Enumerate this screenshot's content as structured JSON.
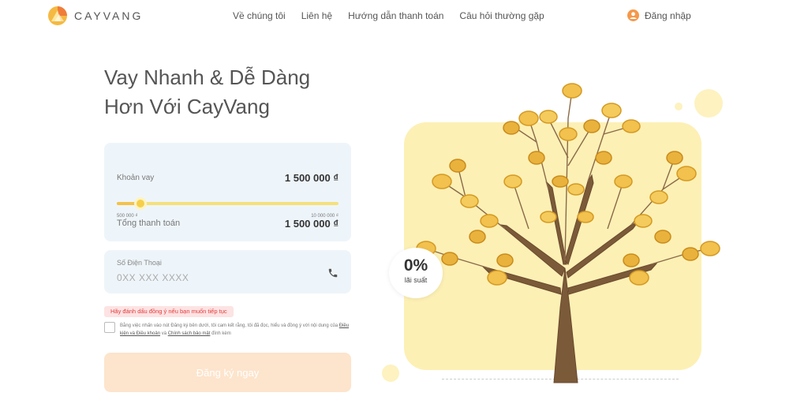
{
  "header": {
    "brand": "CAYVANG",
    "nav": [
      {
        "label": "Về chúng tôi"
      },
      {
        "label": "Liên hệ"
      },
      {
        "label": "Hướng dẫn thanh toán"
      },
      {
        "label": "Câu hỏi thường gặp"
      }
    ],
    "login_label": "Đăng nhập"
  },
  "hero": {
    "title_line1": "Vay Nhanh & Dễ Dàng",
    "title_line2": "Hơn Với CayVang"
  },
  "loan": {
    "label": "Khoản vay",
    "amount": "1 500 000 ₫",
    "slider_min": "500 000 ₫",
    "slider_max": "10 000 000 ₫",
    "slider_fraction": 0.105,
    "total_label": "Tổng thanh toán",
    "total_amount": "1 500 000 ₫"
  },
  "phone": {
    "label": "Số Điện Thoại",
    "placeholder": "0XX XXX XXXX",
    "icon": "phone-icon"
  },
  "agreement": {
    "warning": "Hãy đánh dấu đồng ý nếu bạn muốn tiếp tục",
    "text_before": "Bằng việc nhấn vào nút Đăng ký bên dưới, tôi cam kết rằng, tôi đã đọc, hiểu và đồng ý với nội dung của ",
    "terms_link": "Điều kiện và Điều khoản",
    "text_middle": " và ",
    "privacy_link": "Chính sách bảo mật",
    "text_after": " đính kèm",
    "checked": false
  },
  "submit_label": "Đăng ký ngay",
  "promo": {
    "rate": "0%",
    "rate_label": "lãi suất"
  },
  "colors": {
    "accent_orange": "#f5984a",
    "slider_yellow": "#f5cf4a",
    "card_bg": "#eef5fa",
    "illustration_bg": "#fdf0b5",
    "warning_red": "#e23b3b"
  }
}
